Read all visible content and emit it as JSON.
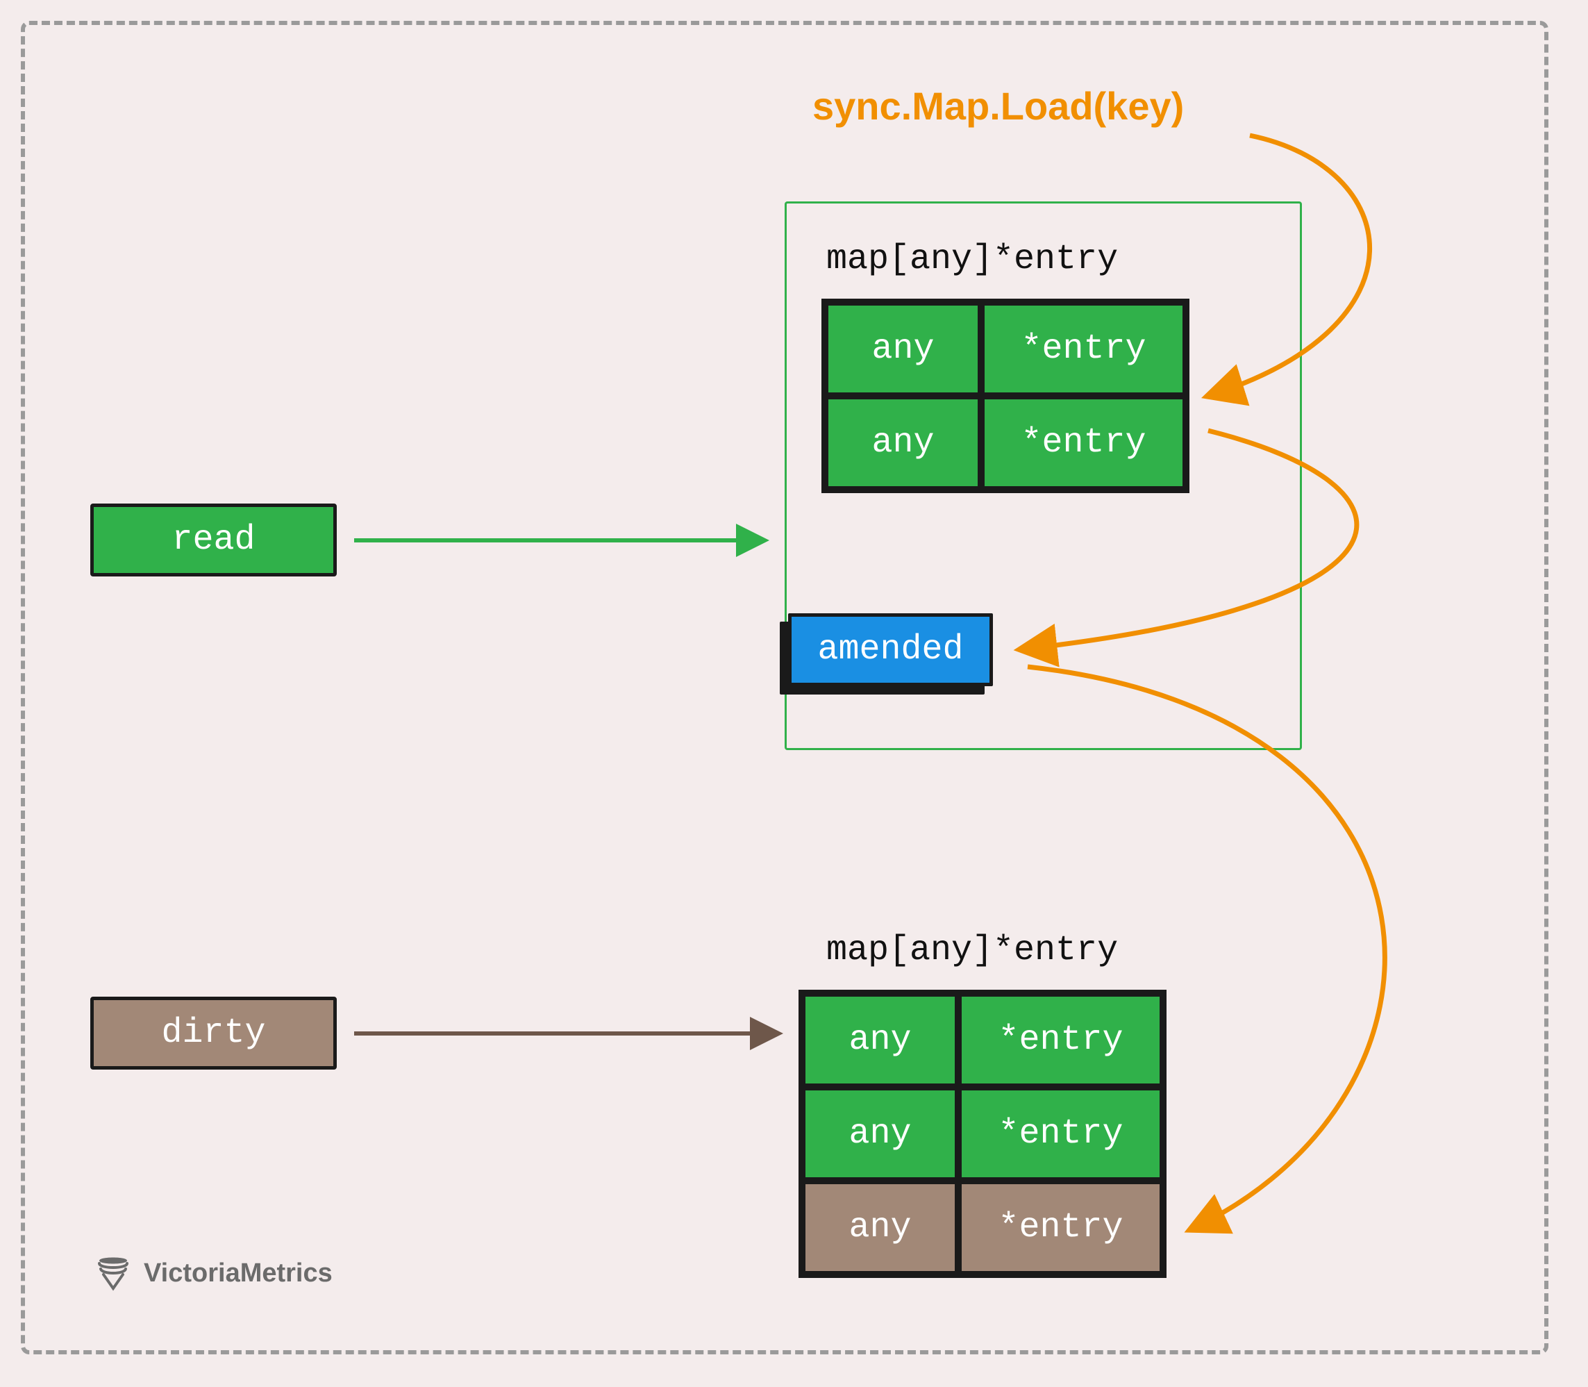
{
  "title": "sync.Map.Load(key)",
  "read_label": "read",
  "dirty_label": "dirty",
  "amended_label": "amended",
  "map_type_label": "map[any]*entry",
  "read_map": {
    "rows": [
      {
        "key": "any",
        "value": "*entry",
        "color": "green"
      },
      {
        "key": "any",
        "value": "*entry",
        "color": "green"
      }
    ]
  },
  "dirty_map": {
    "rows": [
      {
        "key": "any",
        "value": "*entry",
        "color": "green"
      },
      {
        "key": "any",
        "value": "*entry",
        "color": "green"
      },
      {
        "key": "any",
        "value": "*entry",
        "color": "brown"
      }
    ]
  },
  "load_flow_targets": [
    "read_map_entry",
    "amended_flag",
    "dirty_map_entry"
  ],
  "watermark": "VictoriaMetrics",
  "colors": {
    "green": "#30b14a",
    "blue": "#1a8fe3",
    "brown": "#a28877",
    "orange": "#F18F01",
    "border_gray": "#9a9a9a",
    "bg": "#f4ecec"
  }
}
